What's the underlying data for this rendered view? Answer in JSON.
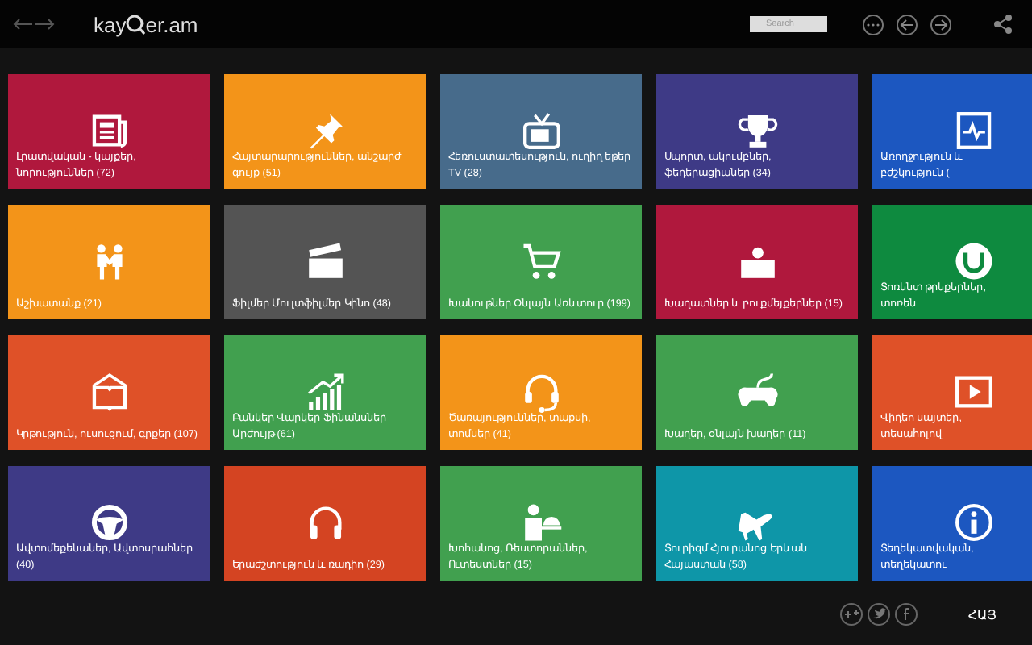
{
  "header": {
    "logo_start": "kay",
    "logo_end": "er.am",
    "search": {
      "placeholder": "Search"
    }
  },
  "tiles": [
    {
      "label": "Լրատվական - կայքեր, նորություններ (72)",
      "color": "#b0183d"
    },
    {
      "label": "Հայտարարություններ, անշարժ գույք (51)",
      "color": "#f39419"
    },
    {
      "label": "Հեռուստատեսություն, ուղիղ եթեր TV (28)",
      "color": "#476b8b"
    },
    {
      "label": "Սպորտ, ակումբներ, ֆեդերացիաներ (34)",
      "color": "#3e3a86"
    },
    {
      "label": "Առողջություն և բժշկություն (",
      "color": "#1c57c0"
    },
    {
      "label": "Աշխատանք (21)",
      "color": "#f39419"
    },
    {
      "label": "Ֆիլմեր Մուլտֆիլմեր Կինո (48)",
      "color": "#545454"
    },
    {
      "label": "Խանութներ Օնլայն Առևտուր (199)",
      "color": "#41a04f"
    },
    {
      "label": "Խաղատներ և բուքմեյքերներ (15)",
      "color": "#b0183d"
    },
    {
      "label": "Տոռենտ թրեքերներ, տոռեն",
      "color": "#0e8a3f"
    },
    {
      "label": "Կրթություն, ուսուցում, գրքեր (107)",
      "color": "#df5128"
    },
    {
      "label": "Բանկեր Վարկեր Ֆինանսներ Արժույթ (61)",
      "color": "#41a04f"
    },
    {
      "label": "Ծառայություններ, տաքսի, տոմսեր (41)",
      "color": "#f39419"
    },
    {
      "label": "Խաղեր, օնլայն խաղեր (11)",
      "color": "#41a04f"
    },
    {
      "label": "Վիդեո սայտեր, տեսահոլով",
      "color": "#df5128"
    },
    {
      "label": "Ավտոմեքենաներ, Ավտոսրահներ (40)",
      "color": "#3e3a86"
    },
    {
      "label": "Երաժշտություն և ռադիո (29)",
      "color": "#d44422"
    },
    {
      "label": "Խոհանոց, Ռեստորաններ, Ուտեստներ (15)",
      "color": "#41a04f"
    },
    {
      "label": "Տուրիզմ Հյուրանոց Երևան Հայաստան (58)",
      "color": "#0e96a8"
    },
    {
      "label": "Տեղեկատվական, տեղեկատու",
      "color": "#1c57c0"
    }
  ],
  "footer": {
    "language": "ՀԱՅ"
  }
}
